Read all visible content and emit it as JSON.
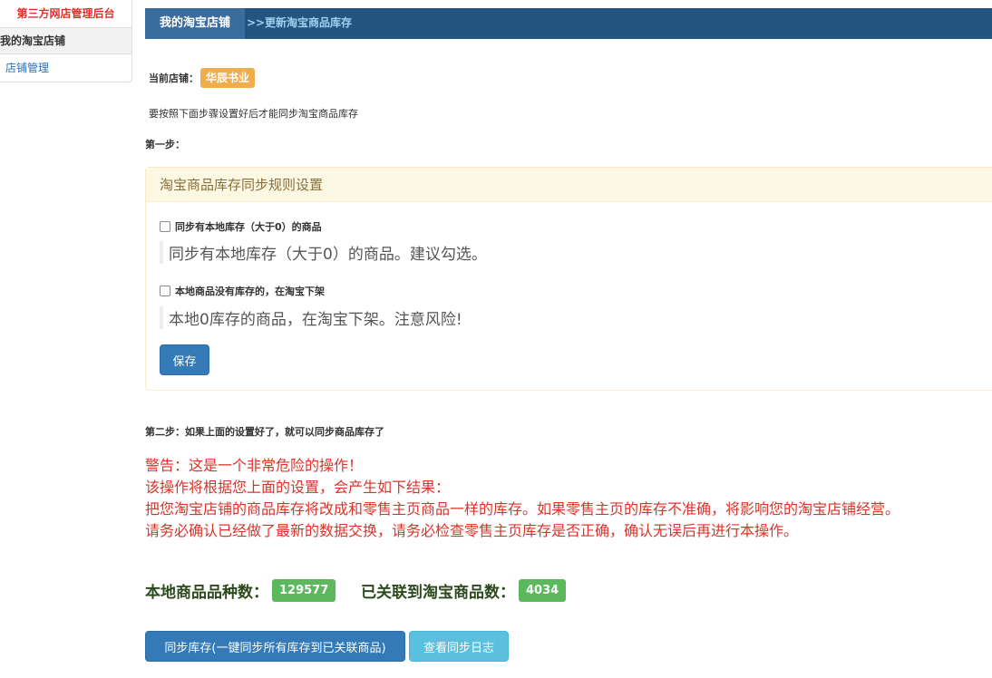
{
  "sidebar": {
    "title": "第三方网店管理后台",
    "group": "我的淘宝店铺",
    "items": [
      {
        "label": "店铺管理"
      }
    ]
  },
  "breadcrumb": {
    "home": "我的淘宝店铺",
    "separator": ">>",
    "current": "更新淘宝商品库存"
  },
  "store": {
    "label": "当前店铺：",
    "name": "华辰书业"
  },
  "hint": "要按照下面步骤设置好后才能同步淘宝商品库存",
  "step1": {
    "label": "第一步：",
    "panel_title": "淘宝商品库存同步规则设置",
    "options": [
      {
        "label": "同步有本地库存（大于0）的商品",
        "description": "同步有本地库存（大于0）的商品。建议勾选。",
        "checked": false
      },
      {
        "label": "本地商品没有库存的，在淘宝下架",
        "description": "本地0库存的商品，在淘宝下架。注意风险!",
        "checked": false
      }
    ],
    "save_label": "保存"
  },
  "step2": {
    "label": "第二步：如果上面的设置好了，就可以同步商品库存了"
  },
  "warning": {
    "lines": [
      "警告：这是一个非常危险的操作！",
      "该操作将根据您上面的设置，会产生如下结果：",
      "把您淘宝店铺的商品库存将改成和零售主页商品一样的库存。如果零售主页的库存不准确，将影响您的淘宝店铺经营。",
      "请务必确认已经做了最新的数据交换，请务必检查零售主页库存是否正确，确认无误后再进行本操作。"
    ]
  },
  "stats": {
    "local_label": "本地商品品种数：",
    "local_count": "129577",
    "linked_label": "已关联到淘宝商品数：",
    "linked_count": "4034"
  },
  "actions": {
    "sync_label": "同步库存(一键同步所有库存到已关联商品)",
    "log_label": "查看同步日志"
  },
  "colors": {
    "nav_bar": "#245580",
    "primary": "#337ab7",
    "warning_text": "#d9342b",
    "badge_orange": "#f0ad4e",
    "badge_green": "#5cb85c",
    "info_button": "#5bc0de"
  }
}
